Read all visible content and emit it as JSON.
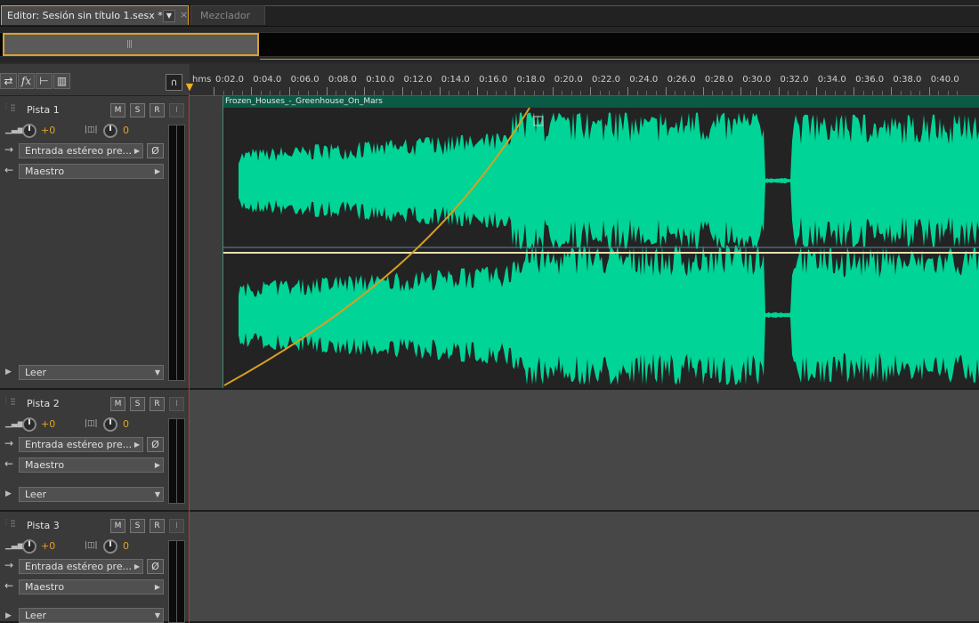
{
  "tabs": {
    "active_label": "Editor: Sesión sin título 1.sesx *",
    "dropdown_glyph": "▼",
    "close_glyph": "×",
    "inactive_label": "Mezclador"
  },
  "toolbar": {
    "icons": [
      "loop-icon",
      "fx-icon",
      "sends-icon",
      "eq-icon"
    ],
    "fx_label": "fx",
    "headphone_glyph": "🎧"
  },
  "ruler": {
    "unit": "hms",
    "labels": [
      "0:02.0",
      "0:04.0",
      "0:06.0",
      "0:08.0",
      "0:10.0",
      "0:12.0",
      "0:14.0",
      "0:16.0",
      "0:18.0",
      "0:20.0",
      "0:22.0",
      "0:24.0",
      "0:26.0",
      "0:28.0",
      "0:30.0",
      "0:32.0",
      "0:34.0",
      "0:36.0",
      "0:38.0",
      "0:40.0"
    ]
  },
  "tracks": [
    {
      "name": "Pista 1",
      "mute": "M",
      "solo": "S",
      "record": "R",
      "input_monitor": "I",
      "volume": "+0",
      "pan": "0",
      "input": "Entrada estéreo pre...",
      "output": "Maestro",
      "automation": "Leer"
    },
    {
      "name": "Pista 2",
      "mute": "M",
      "solo": "S",
      "record": "R",
      "input_monitor": "I",
      "volume": "+0",
      "pan": "0",
      "input": "Entrada estéreo pre...",
      "output": "Maestro",
      "automation": "Leer"
    },
    {
      "name": "Pista 3",
      "mute": "M",
      "solo": "S",
      "record": "R",
      "input_monitor": "I",
      "volume": "+0",
      "pan": "0",
      "input": "Entrada estéreo pre...",
      "output": "Maestro",
      "automation": "Leer"
    }
  ],
  "clip": {
    "name": "Frozen_Houses_-_Greenhouse_On_Mars",
    "waveform_color": "#00d496",
    "fade_line_color": "#d8a020"
  },
  "colors": {
    "accent": "#e0a020",
    "playhead": "#c53030",
    "knob_value": "#e2a12a"
  }
}
